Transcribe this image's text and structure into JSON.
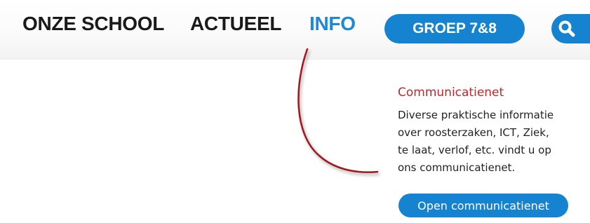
{
  "nav": {
    "items": [
      {
        "label": "ONZE SCHOOL"
      },
      {
        "label": "ACTUEEL"
      },
      {
        "label": "INFO"
      }
    ],
    "groep_button": "GROEP 7&8",
    "search_icon": "search-icon",
    "active_color": "#1e88d4",
    "accent_color": "#1583cf"
  },
  "panel": {
    "title": "Communicatienet",
    "lines": [
      "Diverse praktische informatie",
      "over roosterzaken, ICT, Ziek,",
      "te laat, verlof, etc. vindt u op",
      "ons communicatienet."
    ],
    "button": "Open communicatienet",
    "title_color": "#c0272d"
  },
  "annotation": {
    "arrow_color": "#a3141d"
  }
}
